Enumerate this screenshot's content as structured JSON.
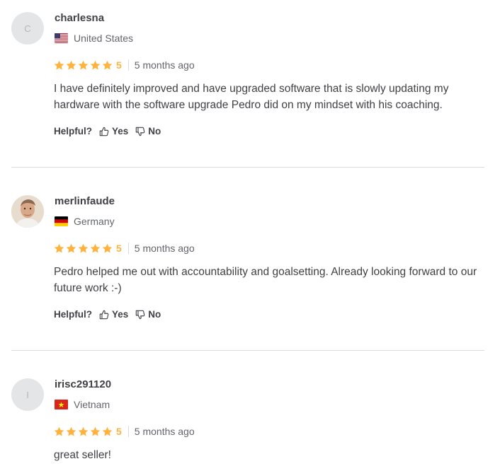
{
  "reviews": [
    {
      "avatar_letter": "C",
      "username": "charlesna",
      "country": "United States",
      "flag": "us-flag",
      "rating": "5",
      "time": "5 months ago",
      "text": "I have definitely improved and have upgraded software that is slowly updating my hardware with the software upgrade Pedro did on my mindset with his coaching.",
      "helpful_label": "Helpful?",
      "yes_label": "Yes",
      "no_label": "No"
    },
    {
      "avatar_letter": "",
      "username": "merlinfaude",
      "country": "Germany",
      "flag": "germany-flag",
      "rating": "5",
      "time": "5 months ago",
      "text": "Pedro helped me out with accountability and goalsetting. Already looking forward to our future work :-)",
      "helpful_label": "Helpful?",
      "yes_label": "Yes",
      "no_label": "No"
    },
    {
      "avatar_letter": "I",
      "username": "irisc291120",
      "country": "Vietnam",
      "flag": "vietnam-flag",
      "rating": "5",
      "time": "5 months ago",
      "text": "great seller!"
    }
  ],
  "colors": {
    "star": "#ffb33e",
    "text": "#404145",
    "muted": "#62646a",
    "divider": "#dadbdd"
  }
}
